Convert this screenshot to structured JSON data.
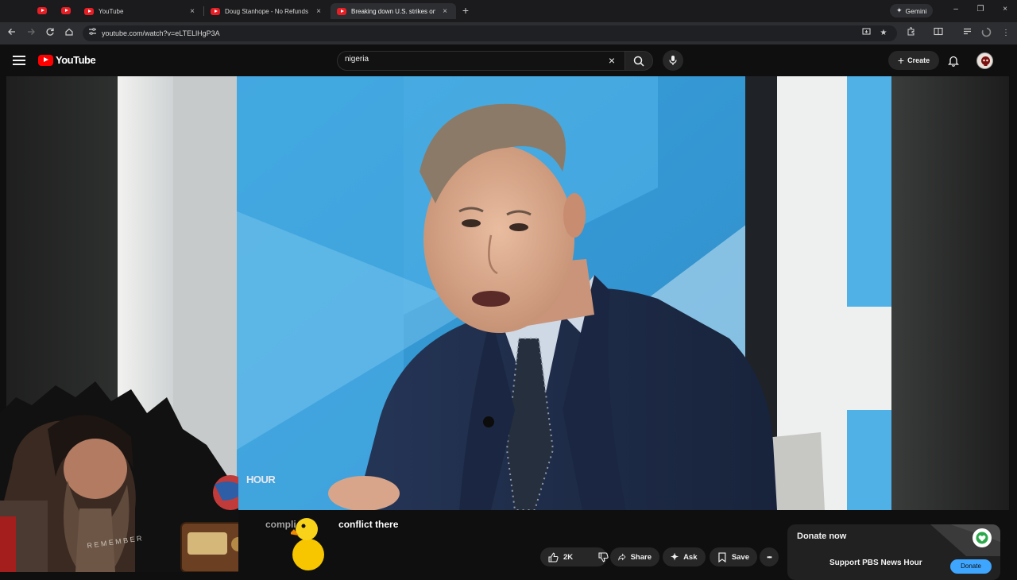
{
  "browser": {
    "tabs": [
      {
        "title": "YouTube",
        "close": "×"
      },
      {
        "title": "Doug Stanhope - No Refunds",
        "close": "×"
      },
      {
        "title": "Breaking down U.S. strikes on N",
        "close": "×"
      }
    ],
    "new_tab": "+",
    "gemini_label": "Gemini",
    "url": "youtube.com/watch?v=eLTELlHgP3A",
    "window_controls": {
      "minimize": "–",
      "restore": "❐",
      "close": "×"
    }
  },
  "masthead": {
    "logo_text": "YouTube",
    "search_value": "nigeria",
    "search_clear": "×",
    "create_label": "Create",
    "create_icon": "+"
  },
  "overlay": {
    "caption_faded": "compli",
    "caption_main": "conflict there",
    "lower_third": "HOUR"
  },
  "actions": {
    "likes": "2K",
    "share": "Share",
    "ask": "Ask",
    "save": "Save",
    "more": "•••"
  },
  "donate": {
    "title": "Donate now",
    "subtitle": "Support PBS News Hour",
    "button": "Donate"
  },
  "colors": {
    "youtube_red": "#ff0000",
    "donate_blue": "#3ea6ff",
    "studio_blue": "#3b9fd8",
    "suit_navy": "#1f2c47"
  }
}
